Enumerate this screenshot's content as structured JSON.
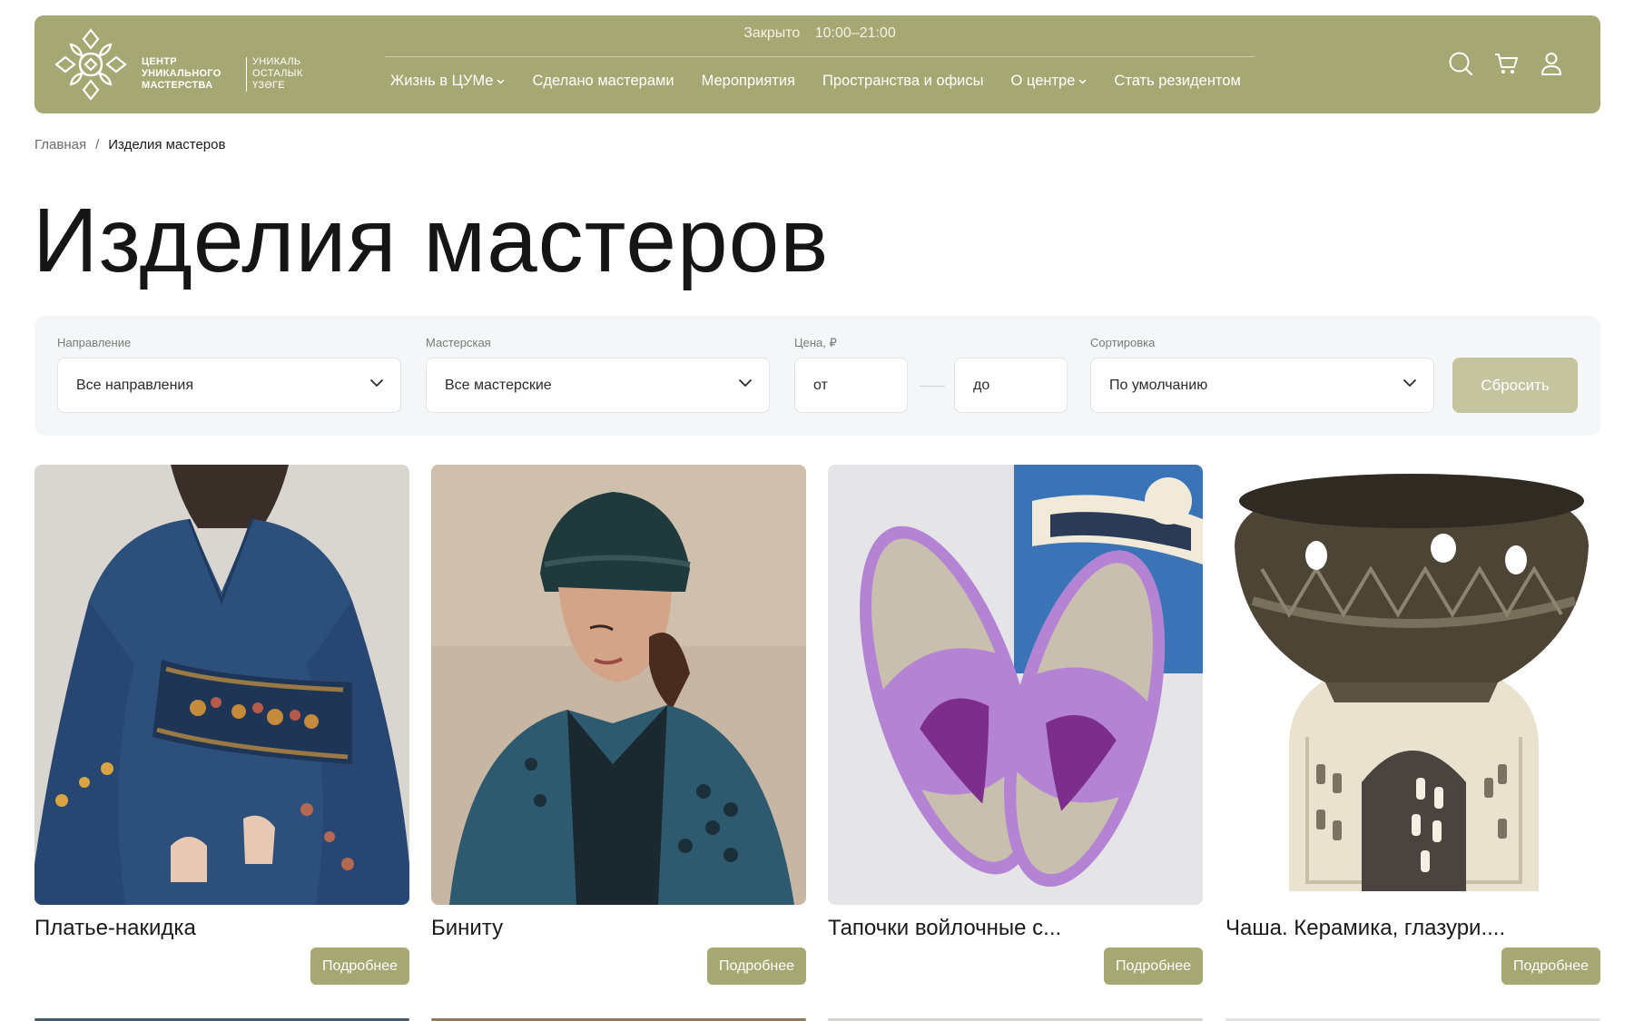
{
  "header": {
    "logo_left": [
      "ЦЕНТР",
      "УНИКАЛЬНОГО",
      "МАСТЕРСТВА"
    ],
    "logo_right": [
      "УНИКАЛЬ",
      "ОСТАЛЫК",
      "ҮЗӘГЕ"
    ],
    "status_label": "Закрыто",
    "hours": "10:00–21:00",
    "nav": [
      {
        "label": "Жизнь в ЦУМе",
        "dropdown": true
      },
      {
        "label": "Сделано мастерами",
        "dropdown": false
      },
      {
        "label": "Мероприятия",
        "dropdown": false
      },
      {
        "label": "Пространства и офисы",
        "dropdown": false
      },
      {
        "label": "О центре",
        "dropdown": true
      },
      {
        "label": "Стать резидентом",
        "dropdown": false
      }
    ],
    "icons": [
      "search-icon",
      "cart-icon",
      "user-icon"
    ]
  },
  "breadcrumb": {
    "home": "Главная",
    "separator": "/",
    "current": "Изделия мастеров"
  },
  "page_title": "Изделия мастеров",
  "filters": {
    "direction": {
      "label": "Направление",
      "value": "Все направления"
    },
    "workshop": {
      "label": "Мастерская",
      "value": "Все мастерские"
    },
    "price": {
      "label": "Цена, ₽",
      "from_placeholder": "от",
      "to_placeholder": "до"
    },
    "sort": {
      "label": "Сортировка",
      "value": "По умолчанию"
    },
    "reset_label": "Сбросить"
  },
  "products": [
    {
      "title": "Платье-накидка",
      "button": "Подробнее"
    },
    {
      "title": "Биниту",
      "button": "Подробнее"
    },
    {
      "title": "Тапочки войлочные с...",
      "button": "Подробнее"
    },
    {
      "title": "Чаша. Керамика, глазури....",
      "button": "Подробнее"
    }
  ],
  "colors": {
    "brand": "#a6a873",
    "brand_light": "#c4c59f",
    "filter_bg": "#f5f6f8"
  }
}
